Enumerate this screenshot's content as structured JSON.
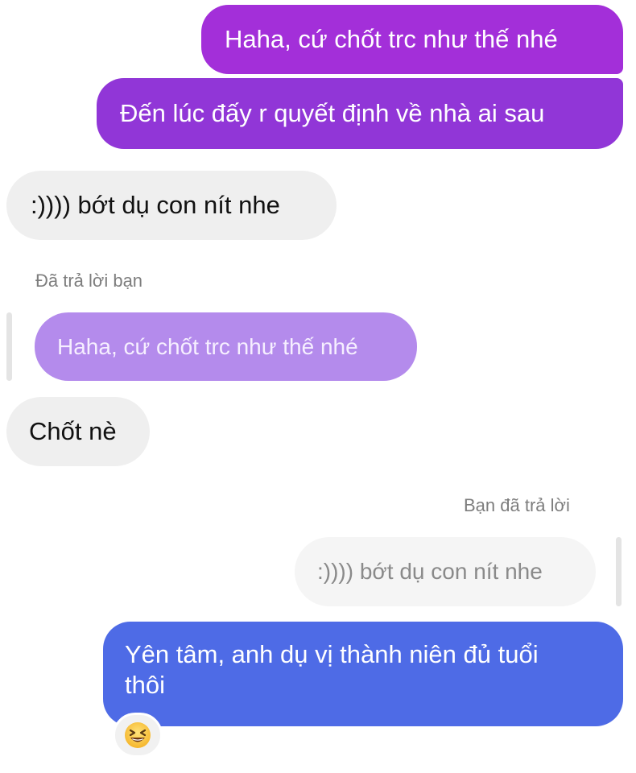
{
  "messages": [
    {
      "id": "m1",
      "direction": "sent",
      "text": "Haha, cứ chốt trc như thế nhé"
    },
    {
      "id": "m2",
      "direction": "sent",
      "text": "Đến lúc đấy r quyết định về nhà ai sau"
    },
    {
      "id": "m3",
      "direction": "received",
      "text": ":)))) bớt dụ con nít nhe"
    },
    {
      "id": "m4",
      "direction": "received",
      "reply_label": "Đã trả lời bạn",
      "quoted_text": "Haha, cứ chốt trc như thế nhé",
      "text": "Chốt nè"
    },
    {
      "id": "m5",
      "direction": "sent",
      "reply_label": "Bạn đã trả lời",
      "quoted_text": ":)))) bớt dụ con nít nhe",
      "text_line1": "Yên tâm, anh dụ vị thành niên đủ tuổi",
      "text_line2": "thôi",
      "reaction": "laughing-squint-emoji"
    }
  ],
  "colors": {
    "sent_gradient_top": "#a030d8",
    "sent_gradient_bottom": "#8a3ed6",
    "sent_blue": "#4e6be6",
    "received_bg": "#efefef",
    "quote_purple": "#b48bec",
    "quote_gray": "#f5f5f5"
  }
}
